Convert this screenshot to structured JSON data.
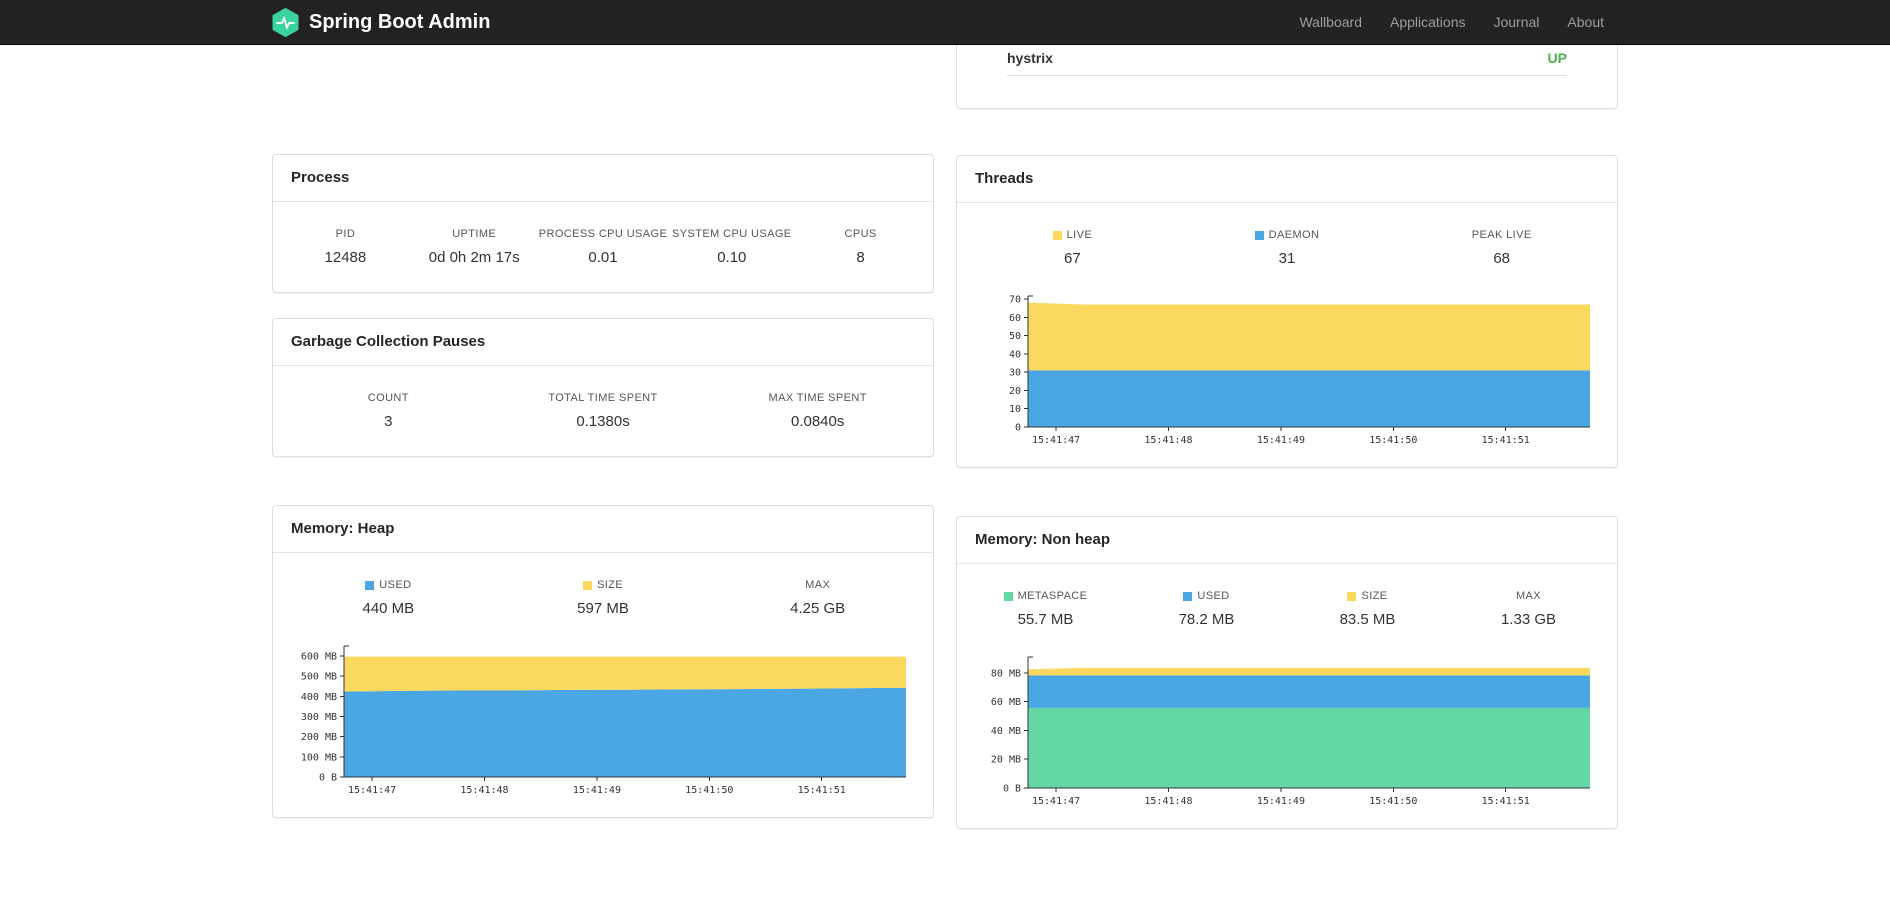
{
  "navbar": {
    "brand": "Spring Boot Admin",
    "links": [
      {
        "label": "Wallboard"
      },
      {
        "label": "Applications"
      },
      {
        "label": "Journal"
      },
      {
        "label": "About"
      }
    ]
  },
  "application_status": {
    "name": "hystrix",
    "status": "UP",
    "status_color": "#4CAF50"
  },
  "panels": {
    "process": {
      "title": "Process",
      "stats": [
        {
          "label": "PID",
          "value": "12488"
        },
        {
          "label": "UPTIME",
          "value": "0d 0h 2m 17s"
        },
        {
          "label": "PROCESS CPU USAGE",
          "value": "0.01"
        },
        {
          "label": "SYSTEM CPU USAGE",
          "value": "0.10"
        },
        {
          "label": "CPUS",
          "value": "8"
        }
      ]
    },
    "gc": {
      "title": "Garbage Collection Pauses",
      "stats": [
        {
          "label": "COUNT",
          "value": "3"
        },
        {
          "label": "TOTAL TIME SPENT",
          "value": "0.1380s"
        },
        {
          "label": "MAX TIME SPENT",
          "value": "0.0840s"
        }
      ]
    },
    "threads": {
      "title": "Threads",
      "stats": [
        {
          "label": "LIVE",
          "value": "67",
          "swatch": "#FBD85E"
        },
        {
          "label": "DAEMON",
          "value": "31",
          "swatch": "#4AA7E4"
        },
        {
          "label": "PEAK LIVE",
          "value": "68"
        }
      ]
    },
    "heap": {
      "title": "Memory: Heap",
      "stats": [
        {
          "label": "USED",
          "value": "440 MB",
          "swatch": "#4AA7E4"
        },
        {
          "label": "SIZE",
          "value": "597 MB",
          "swatch": "#FBD85E"
        },
        {
          "label": "MAX",
          "value": "4.25 GB"
        }
      ]
    },
    "nonheap": {
      "title": "Memory: Non heap",
      "stats": [
        {
          "label": "METASPACE",
          "value": "55.7 MB",
          "swatch": "#63D8A4"
        },
        {
          "label": "USED",
          "value": "78.2 MB",
          "swatch": "#4AA7E4"
        },
        {
          "label": "SIZE",
          "value": "83.5 MB",
          "swatch": "#FBD85E"
        },
        {
          "label": "MAX",
          "value": "1.33 GB"
        }
      ]
    }
  },
  "chart_data": [
    {
      "id": "threads-chart",
      "type": "area",
      "stacked": true,
      "title": "Threads",
      "x_tick_labels": [
        "15:41:47",
        "15:41:48",
        "15:41:49",
        "15:41:50",
        "15:41:51"
      ],
      "x_tick_fractions": [
        0.05,
        0.25,
        0.45,
        0.65,
        0.85
      ],
      "y_max": 70,
      "y_ticks": [
        {
          "v": 0,
          "label": "0"
        },
        {
          "v": 10,
          "label": "10"
        },
        {
          "v": 20,
          "label": "20"
        },
        {
          "v": 30,
          "label": "30"
        },
        {
          "v": 40,
          "label": "40"
        },
        {
          "v": 50,
          "label": "50"
        },
        {
          "v": 60,
          "label": "60"
        },
        {
          "v": 70,
          "label": "70"
        }
      ],
      "series": [
        {
          "name": "DAEMON",
          "color": "#4AA7E4",
          "values": [
            31,
            31,
            31,
            31,
            31,
            31,
            31,
            31,
            31,
            31,
            31
          ]
        },
        {
          "name": "LIVE",
          "color": "#FBD85E",
          "values": [
            68,
            67,
            67,
            67,
            67,
            67,
            67,
            67,
            67,
            67,
            67
          ]
        }
      ]
    },
    {
      "id": "heap-chart",
      "type": "area",
      "stacked": true,
      "title": "Memory: Heap",
      "x_tick_labels": [
        "15:41:47",
        "15:41:48",
        "15:41:49",
        "15:41:50",
        "15:41:51"
      ],
      "x_tick_fractions": [
        0.05,
        0.25,
        0.45,
        0.65,
        0.85
      ],
      "y_max": 635,
      "y_ticks": [
        {
          "v": 0,
          "label": "0 B"
        },
        {
          "v": 100,
          "label": "100 MB"
        },
        {
          "v": 200,
          "label": "200 MB"
        },
        {
          "v": 300,
          "label": "300 MB"
        },
        {
          "v": 400,
          "label": "400 MB"
        },
        {
          "v": 500,
          "label": "500 MB"
        },
        {
          "v": 600,
          "label": "600 MB"
        }
      ],
      "series": [
        {
          "name": "USED",
          "color": "#4AA7E4",
          "values": [
            424,
            427,
            429,
            430,
            432,
            433,
            435,
            436,
            438,
            440,
            443
          ]
        },
        {
          "name": "SIZE",
          "color": "#FBD85E",
          "values": [
            597,
            597,
            597,
            597,
            597,
            597,
            597,
            597,
            597,
            597,
            597
          ]
        }
      ]
    },
    {
      "id": "nonheap-chart",
      "type": "area",
      "stacked": true,
      "title": "Memory: Non heap",
      "x_tick_labels": [
        "15:41:47",
        "15:41:48",
        "15:41:49",
        "15:41:50",
        "15:41:51"
      ],
      "x_tick_fractions": [
        0.05,
        0.25,
        0.45,
        0.65,
        0.85
      ],
      "y_max": 89,
      "y_ticks": [
        {
          "v": 0,
          "label": "0 B"
        },
        {
          "v": 20,
          "label": "20 MB"
        },
        {
          "v": 40,
          "label": "40 MB"
        },
        {
          "v": 60,
          "label": "60 MB"
        },
        {
          "v": 80,
          "label": "80 MB"
        }
      ],
      "series": [
        {
          "name": "METASPACE",
          "color": "#63D8A4",
          "values": [
            55.7,
            55.7,
            55.7,
            55.7,
            55.7,
            55.7,
            55.7,
            55.7,
            55.7,
            55.7,
            55.7
          ]
        },
        {
          "name": "USED",
          "color": "#4AA7E4",
          "values": [
            78.2,
            78.2,
            78.2,
            78.2,
            78.2,
            78.2,
            78.2,
            78.2,
            78.2,
            78.2,
            78.2
          ]
        },
        {
          "name": "SIZE",
          "color": "#FBD85E",
          "values": [
            82.6,
            83.5,
            83.5,
            83.5,
            83.5,
            83.5,
            83.5,
            83.5,
            83.5,
            83.5,
            83.5
          ]
        }
      ]
    }
  ]
}
